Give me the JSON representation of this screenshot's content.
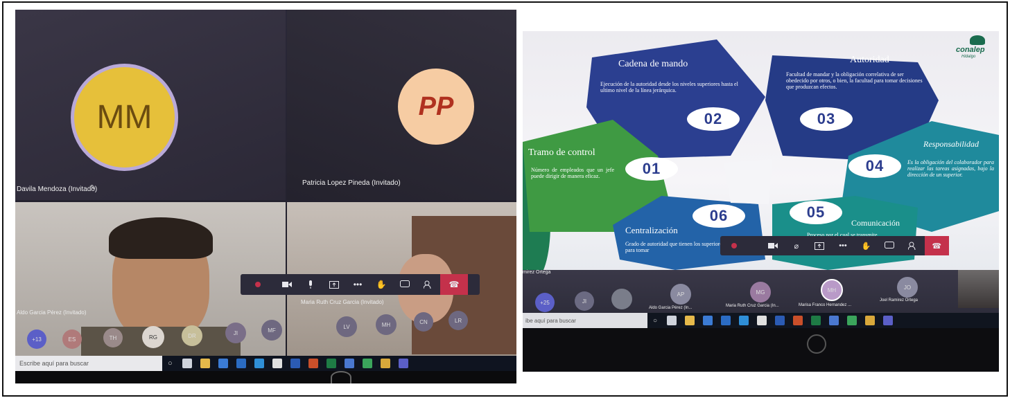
{
  "photo1": {
    "participants": [
      {
        "initials": "MM",
        "name": "Davila Mendoza (Invitado)"
      },
      {
        "initials": "PP",
        "name": "Patricia Lopez Pineda (Invitado)"
      },
      {
        "name": "Aldo Garcia Pérez (Invitado)"
      },
      {
        "name": "Maria Ruth Cruz Garcia (Invitado)"
      }
    ],
    "roster_chips": [
      "+13",
      "ES",
      "TH",
      "RG",
      "DR",
      "JI",
      "MF",
      "LV",
      "MH",
      "CN",
      "LR"
    ],
    "search_placeholder": "Escribe aquí para buscar"
  },
  "photo2": {
    "logo": {
      "name": "conalep",
      "subtitle": "Hidalgo"
    },
    "slide": {
      "items": [
        {
          "num": "01",
          "title": "Tramo de control",
          "text": "Número de empleados que un jefe puede dirigir de manera eficaz.",
          "color": "#3f9a43"
        },
        {
          "num": "02",
          "title": "Cadena de mando",
          "text": "Ejecución de la autoridad desde los niveles superiores hasta el ultimo nivel de la línea jerárquica.",
          "color": "#2a3f8f"
        },
        {
          "num": "03",
          "title": "Autoridad",
          "text": "Facultad de mandar y la obligación correlativa de ser obedecido por otros, o bien, la facultad para tomar decisiones que produzcan efectos.",
          "color": "#243a85"
        },
        {
          "num": "04",
          "title": "Responsabilidad",
          "text": "Es la obligación del colaborador para realizar las tareas asignadas, bajo la dirección de un superior.",
          "color": "#1f8a9c"
        },
        {
          "num": "05",
          "title": "Comunicación",
          "text": "Proceso por el cual se transmite",
          "color": "#1a8f8a"
        },
        {
          "num": "06",
          "title": "Centralización",
          "text": "Grado de autoridad que tienen los superiores de mando para tomar",
          "color": "#2363a8"
        }
      ]
    },
    "speaker_label": "mirez Ortega",
    "roster": [
      {
        "initials": "AP",
        "name": "Aldo Garcia Pérez (In..."
      },
      {
        "initials": "MG",
        "name": "Maria Ruth Cruz Garcia (In..."
      },
      {
        "initials": "MH",
        "name": "Marisa Franco Hernandez ..."
      },
      {
        "initials": "JO",
        "name": "Joel Ramirez Ortega"
      }
    ],
    "roster_chips": [
      "+25",
      "JI"
    ],
    "search_placeholder": "ibe aquí para buscar"
  },
  "colors": {
    "leave": "#c4314b",
    "teams_bg": "#2d2c3e",
    "mm_avatar": "#e9c13a",
    "pp_avatar": "#f5c8a0"
  },
  "icons": [
    "video-icon",
    "mic-icon",
    "share-screen-icon",
    "more-icon",
    "raise-hand-icon",
    "chat-icon",
    "people-icon",
    "hang-up-icon"
  ]
}
